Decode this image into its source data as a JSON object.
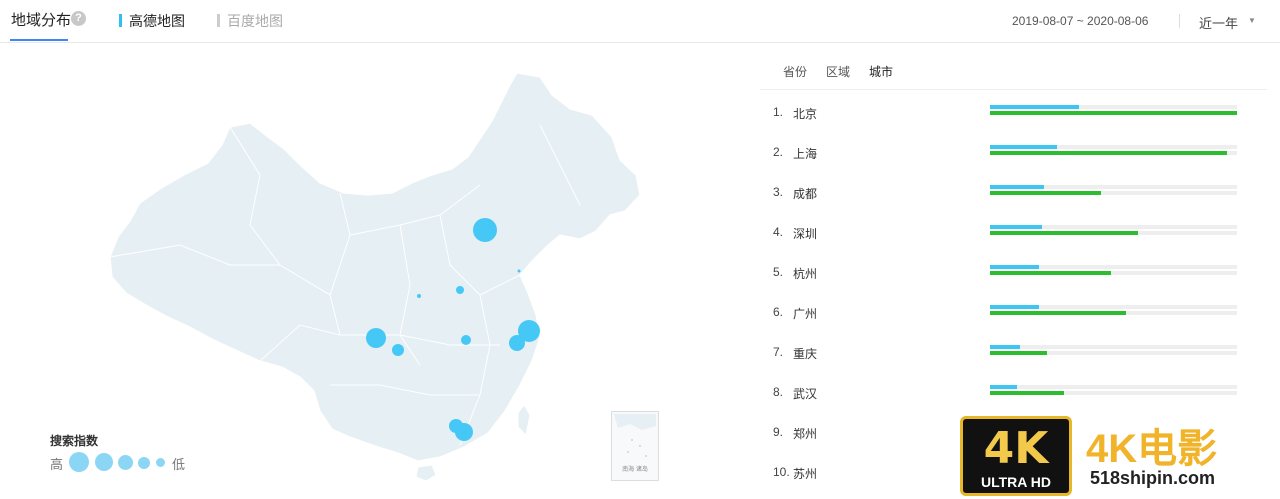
{
  "header": {
    "title": "地域分布",
    "help_icon": "?",
    "tabs": [
      {
        "label": "高德地图",
        "active": true
      },
      {
        "label": "百度地图",
        "active": false
      }
    ],
    "date_range": "2019-08-07 ~ 2020-08-06",
    "period": "近一年",
    "period_caret": "▼"
  },
  "legend": {
    "title": "搜索指数",
    "high": "高",
    "low": "低"
  },
  "inset_label": "南海\n诸岛",
  "subtabs": [
    {
      "label": "省份",
      "active": false
    },
    {
      "label": "区域",
      "active": false
    },
    {
      "label": "城市",
      "active": true
    }
  ],
  "ranking": [
    {
      "rank": "1.",
      "city": "北京",
      "blue": 0.36,
      "green": 1.0
    },
    {
      "rank": "2.",
      "city": "上海",
      "blue": 0.27,
      "green": 0.96
    },
    {
      "rank": "3.",
      "city": "成都",
      "blue": 0.22,
      "green": 0.45
    },
    {
      "rank": "4.",
      "city": "深圳",
      "blue": 0.21,
      "green": 0.6
    },
    {
      "rank": "5.",
      "city": "杭州",
      "blue": 0.2,
      "green": 0.49
    },
    {
      "rank": "6.",
      "city": "广州",
      "blue": 0.2,
      "green": 0.55
    },
    {
      "rank": "7.",
      "city": "重庆",
      "blue": 0.12,
      "green": 0.23
    },
    {
      "rank": "8.",
      "city": "武汉",
      "blue": 0.11,
      "green": 0.3
    },
    {
      "rank": "9.",
      "city": "郑州",
      "blue": 0.0,
      "green": 0.0
    },
    {
      "rank": "10.",
      "city": "苏州",
      "blue": 0.0,
      "green": 0.0
    }
  ],
  "colors": {
    "accent": "#3f86f5",
    "blue_series": "#3ec6f2",
    "green_series": "#2cbd30",
    "map_fill": "#e6eff3",
    "bubble": "#45c8f5"
  },
  "watermark": {
    "badge_main": "4K",
    "badge_sub": "ULTRA HD",
    "brand": "4K电影",
    "url": "518shipin.com"
  }
}
